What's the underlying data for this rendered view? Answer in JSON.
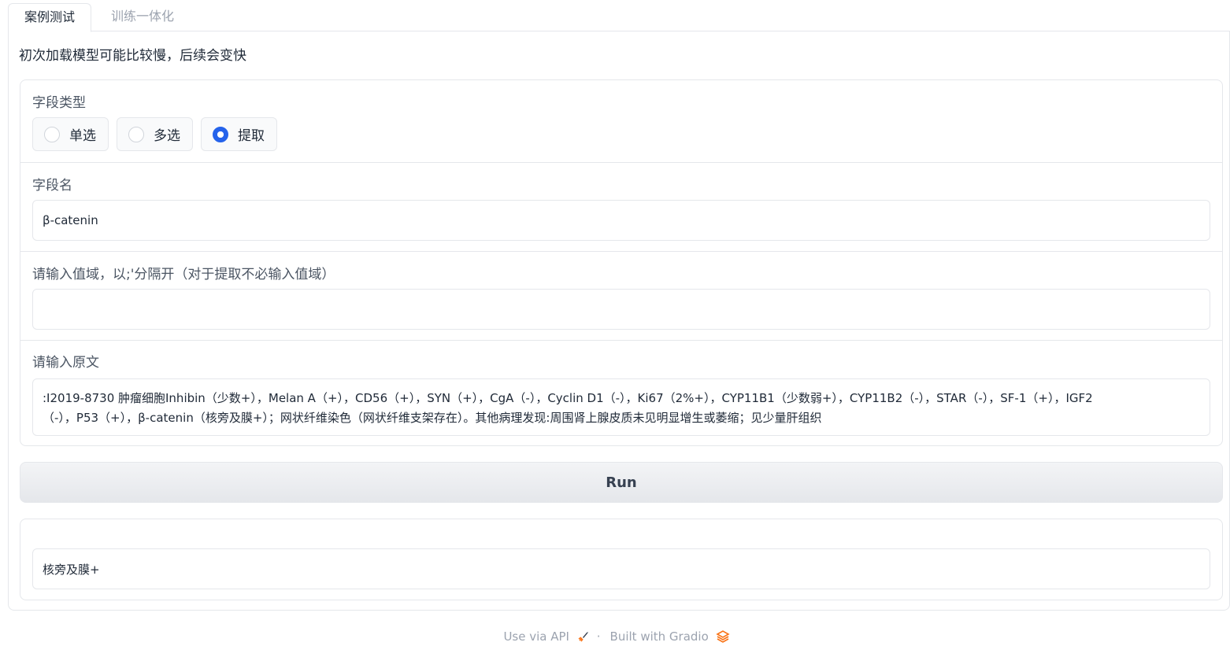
{
  "tabs": [
    {
      "label": "案例测试",
      "active": true
    },
    {
      "label": "训练一体化",
      "active": false
    }
  ],
  "intro_text": "初次加载模型可能比较慢，后续会变快",
  "field_type": {
    "label": "字段类型",
    "options": [
      "单选",
      "多选",
      "提取"
    ],
    "selected": "提取"
  },
  "field_name": {
    "label": "字段名",
    "value": "β-catenin"
  },
  "value_domain": {
    "label": "请输入值域，以;'分隔开（对于提取不必输入值域）",
    "value": ""
  },
  "source_text": {
    "label": "请输入原文",
    "line1": ":I2019-8730 肿瘤细胞Inhibin（少数+），Melan A（+），CD56（+），SYN（+），CgA（-），Cyclin D1（-），Ki67（2%+），CYP11B1（少数弱+），CYP11B2（-），STAR（-），SF-1（+），IGF2",
    "line2": "（-），P53（+），β-catenin（核旁及膜+）；网状纤维染色（网状纤维支架存在）。其他病理发现:周围肾上腺皮质未见明显增生或萎缩；见少量肝组织"
  },
  "run_button": {
    "label": "Run"
  },
  "output": {
    "value": "核旁及膜+"
  },
  "footer": {
    "api_label": "Use via API",
    "separator": "·",
    "built_label": "Built with Gradio"
  },
  "colors": {
    "accent": "#2563eb",
    "gradio_orange": "#f97316"
  }
}
